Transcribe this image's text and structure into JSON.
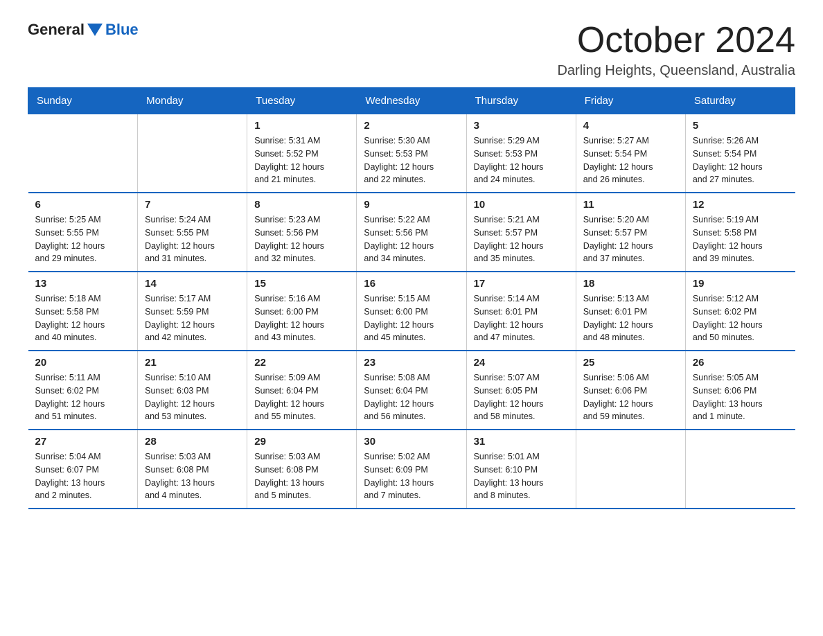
{
  "header": {
    "logo_general": "General",
    "logo_blue": "Blue",
    "title": "October 2024",
    "subtitle": "Darling Heights, Queensland, Australia"
  },
  "weekdays": [
    "Sunday",
    "Monday",
    "Tuesday",
    "Wednesday",
    "Thursday",
    "Friday",
    "Saturday"
  ],
  "weeks": [
    [
      {
        "day": "",
        "info": ""
      },
      {
        "day": "",
        "info": ""
      },
      {
        "day": "1",
        "info": "Sunrise: 5:31 AM\nSunset: 5:52 PM\nDaylight: 12 hours\nand 21 minutes."
      },
      {
        "day": "2",
        "info": "Sunrise: 5:30 AM\nSunset: 5:53 PM\nDaylight: 12 hours\nand 22 minutes."
      },
      {
        "day": "3",
        "info": "Sunrise: 5:29 AM\nSunset: 5:53 PM\nDaylight: 12 hours\nand 24 minutes."
      },
      {
        "day": "4",
        "info": "Sunrise: 5:27 AM\nSunset: 5:54 PM\nDaylight: 12 hours\nand 26 minutes."
      },
      {
        "day": "5",
        "info": "Sunrise: 5:26 AM\nSunset: 5:54 PM\nDaylight: 12 hours\nand 27 minutes."
      }
    ],
    [
      {
        "day": "6",
        "info": "Sunrise: 5:25 AM\nSunset: 5:55 PM\nDaylight: 12 hours\nand 29 minutes."
      },
      {
        "day": "7",
        "info": "Sunrise: 5:24 AM\nSunset: 5:55 PM\nDaylight: 12 hours\nand 31 minutes."
      },
      {
        "day": "8",
        "info": "Sunrise: 5:23 AM\nSunset: 5:56 PM\nDaylight: 12 hours\nand 32 minutes."
      },
      {
        "day": "9",
        "info": "Sunrise: 5:22 AM\nSunset: 5:56 PM\nDaylight: 12 hours\nand 34 minutes."
      },
      {
        "day": "10",
        "info": "Sunrise: 5:21 AM\nSunset: 5:57 PM\nDaylight: 12 hours\nand 35 minutes."
      },
      {
        "day": "11",
        "info": "Sunrise: 5:20 AM\nSunset: 5:57 PM\nDaylight: 12 hours\nand 37 minutes."
      },
      {
        "day": "12",
        "info": "Sunrise: 5:19 AM\nSunset: 5:58 PM\nDaylight: 12 hours\nand 39 minutes."
      }
    ],
    [
      {
        "day": "13",
        "info": "Sunrise: 5:18 AM\nSunset: 5:58 PM\nDaylight: 12 hours\nand 40 minutes."
      },
      {
        "day": "14",
        "info": "Sunrise: 5:17 AM\nSunset: 5:59 PM\nDaylight: 12 hours\nand 42 minutes."
      },
      {
        "day": "15",
        "info": "Sunrise: 5:16 AM\nSunset: 6:00 PM\nDaylight: 12 hours\nand 43 minutes."
      },
      {
        "day": "16",
        "info": "Sunrise: 5:15 AM\nSunset: 6:00 PM\nDaylight: 12 hours\nand 45 minutes."
      },
      {
        "day": "17",
        "info": "Sunrise: 5:14 AM\nSunset: 6:01 PM\nDaylight: 12 hours\nand 47 minutes."
      },
      {
        "day": "18",
        "info": "Sunrise: 5:13 AM\nSunset: 6:01 PM\nDaylight: 12 hours\nand 48 minutes."
      },
      {
        "day": "19",
        "info": "Sunrise: 5:12 AM\nSunset: 6:02 PM\nDaylight: 12 hours\nand 50 minutes."
      }
    ],
    [
      {
        "day": "20",
        "info": "Sunrise: 5:11 AM\nSunset: 6:02 PM\nDaylight: 12 hours\nand 51 minutes."
      },
      {
        "day": "21",
        "info": "Sunrise: 5:10 AM\nSunset: 6:03 PM\nDaylight: 12 hours\nand 53 minutes."
      },
      {
        "day": "22",
        "info": "Sunrise: 5:09 AM\nSunset: 6:04 PM\nDaylight: 12 hours\nand 55 minutes."
      },
      {
        "day": "23",
        "info": "Sunrise: 5:08 AM\nSunset: 6:04 PM\nDaylight: 12 hours\nand 56 minutes."
      },
      {
        "day": "24",
        "info": "Sunrise: 5:07 AM\nSunset: 6:05 PM\nDaylight: 12 hours\nand 58 minutes."
      },
      {
        "day": "25",
        "info": "Sunrise: 5:06 AM\nSunset: 6:06 PM\nDaylight: 12 hours\nand 59 minutes."
      },
      {
        "day": "26",
        "info": "Sunrise: 5:05 AM\nSunset: 6:06 PM\nDaylight: 13 hours\nand 1 minute."
      }
    ],
    [
      {
        "day": "27",
        "info": "Sunrise: 5:04 AM\nSunset: 6:07 PM\nDaylight: 13 hours\nand 2 minutes."
      },
      {
        "day": "28",
        "info": "Sunrise: 5:03 AM\nSunset: 6:08 PM\nDaylight: 13 hours\nand 4 minutes."
      },
      {
        "day": "29",
        "info": "Sunrise: 5:03 AM\nSunset: 6:08 PM\nDaylight: 13 hours\nand 5 minutes."
      },
      {
        "day": "30",
        "info": "Sunrise: 5:02 AM\nSunset: 6:09 PM\nDaylight: 13 hours\nand 7 minutes."
      },
      {
        "day": "31",
        "info": "Sunrise: 5:01 AM\nSunset: 6:10 PM\nDaylight: 13 hours\nand 8 minutes."
      },
      {
        "day": "",
        "info": ""
      },
      {
        "day": "",
        "info": ""
      }
    ]
  ]
}
